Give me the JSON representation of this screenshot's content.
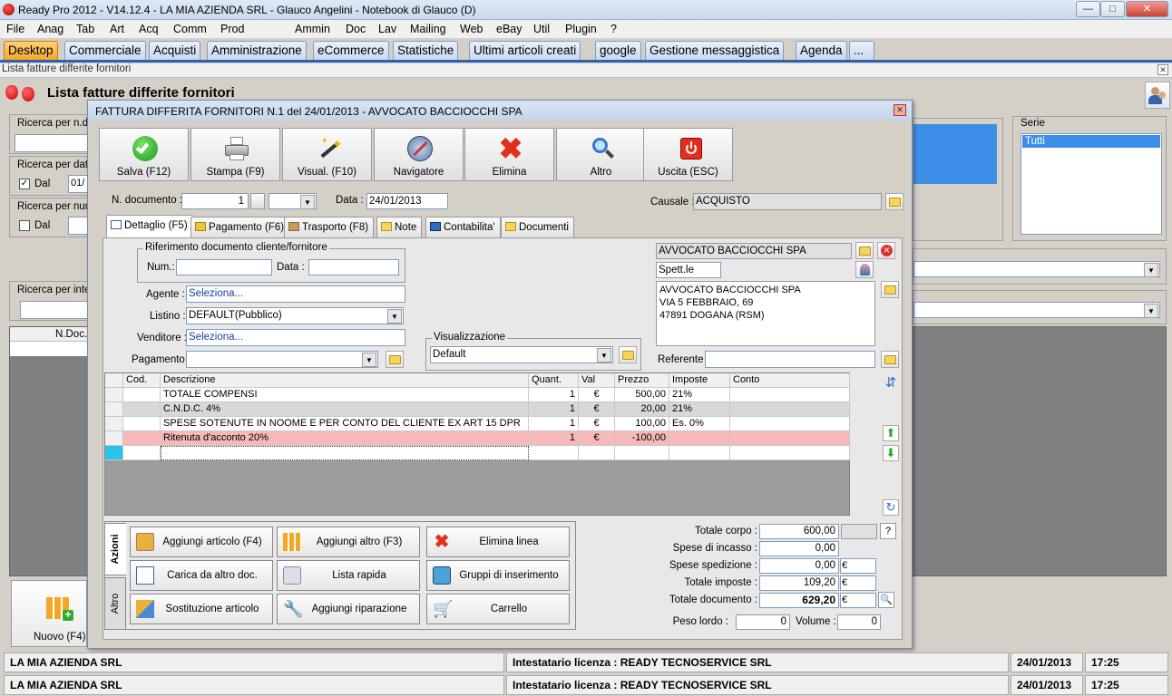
{
  "window": {
    "title": "Ready Pro 2012 - V14.12.4 - LA MIA AZIENDA SRL - Glauco Angelini - Notebook di Glauco (D)"
  },
  "menu": [
    "File",
    "Anag",
    "Tab",
    "Art",
    "Acq",
    "Comm",
    "Prod",
    "Ammin",
    "Doc",
    "Lav",
    "Mailing",
    "Web",
    "eBay",
    "Util",
    "Plugin",
    "?"
  ],
  "tabs": [
    "Desktop",
    "Commerciale",
    "Acquisti",
    "Amministrazione",
    "eCommerce",
    "Statistiche",
    "Ultimi articoli creati",
    "google",
    "Gestione messaggistica",
    "Agenda",
    "..."
  ],
  "path": "Lista fatture differite fornitori",
  "page_title": "Lista fatture differite fornitori",
  "filters": {
    "ricerca_ndoc": "Ricerca per n.do",
    "ricerca_data": "Ricerca per data",
    "dal": "Dal",
    "dal_value": "01/",
    "ricerca_num": "Ricerca per num",
    "dal2": "Dal",
    "ricerca_inte": "Ricerca per inte",
    "col_ndoc": "N.Doc.",
    "serie_label": "Serie",
    "serie_value": "Tutti",
    "nuovo": "Nuovo (F4)"
  },
  "dialog": {
    "title": "FATTURA DIFFERITA FORNITORI N.1  del 24/01/2013 - AVVOCATO BACCIOCCHI SPA",
    "toolbar": [
      "Salva (F12)",
      "Stampa (F9)",
      "Visual. (F10)",
      "Navigatore",
      "Elimina",
      "Altro",
      "Uscita (ESC)"
    ],
    "ndoc_label": "N. documento :",
    "ndoc_value": "1",
    "data_label": "Data :",
    "data_value": "24/01/2013",
    "causale_label": "Causale :",
    "causale_value": "ACQUISTO",
    "subtabs": [
      "Dettaglio (F5)",
      "Pagamento (F6)",
      "Trasporto (F8)",
      "Note",
      "Contabilita'",
      "Documenti"
    ],
    "rif_group": "Riferimento documento cliente/fornitore",
    "num_label": "Num.:",
    "data2_label": "Data :",
    "agente_label": "Agente :",
    "agente_value": "Seleziona...",
    "listino_label": "Listino :",
    "listino_value": "DEFAULT(Pubblico)",
    "venditore_label": "Venditore :",
    "venditore_value": "Seleziona...",
    "pagamento_label": "Pagamento :",
    "visual_group": "Visualizzazione",
    "visual_value": "Default",
    "supplier_name": "AVVOCATO BACCIOCCHI SPA",
    "spett": "Spett.le",
    "address": [
      "AVVOCATO BACCIOCCHI SPA",
      "VIA 5 FEBBRAIO, 69",
      "47891 DOGANA (RSM)"
    ],
    "referente_label": "Referente :",
    "grid_headers": [
      "Cod.",
      "Descrizione",
      "Quant.",
      "Val",
      "Prezzo",
      "Imposte",
      "Conto"
    ],
    "rows": [
      {
        "cod": "",
        "desc": "TOTALE COMPENSI",
        "qty": "1",
        "val": "€",
        "price": "500,00",
        "tax": "21%",
        "conto": ""
      },
      {
        "cod": "",
        "desc": "C.N.D.C. 4%",
        "qty": "1",
        "val": "€",
        "price": "20,00",
        "tax": "21%",
        "conto": ""
      },
      {
        "cod": "",
        "desc": "SPESE SOTENUTE IN NOOME E PER CONTO DEL CLIENTE EX ART 15 DPR",
        "qty": "1",
        "val": "€",
        "price": "100,00",
        "tax": "Es. 0%",
        "conto": ""
      },
      {
        "cod": "",
        "desc": "Ritenuta d'acconto 20%",
        "qty": "1",
        "val": "€",
        "price": "-100,00",
        "tax": "",
        "conto": ""
      }
    ],
    "side_tabs": [
      "Azioni",
      "Altro"
    ],
    "actions": [
      "Aggiungi articolo (F4)",
      "Aggiungi altro (F3)",
      "Elimina linea",
      "Carica da altro doc.",
      "Lista rapida",
      "Gruppi di inserimento",
      "Sostituzione articolo",
      "Aggiungi riparazione",
      "Carrello"
    ],
    "totals": {
      "corpo_label": "Totale corpo :",
      "corpo": "600,00",
      "q": "?",
      "incasso_label": "Spese di incasso :",
      "incasso": "0,00",
      "spedizione_label": "Spese spedizione :",
      "spedizione": "0,00",
      "imposte_label": "Totale imposte :",
      "imposte": "109,20",
      "documento_label": "Totale documento :",
      "documento": "629,20",
      "currency": "€",
      "peso_label": "Peso lordo :",
      "peso": "0",
      "volume_label": "Volume :",
      "volume": "0"
    }
  },
  "status": {
    "company": "LA MIA AZIENDA SRL",
    "license": "Intestatario licenza : READY TECNOSERVICE SRL",
    "date": "24/01/2013",
    "time": "17:25"
  }
}
